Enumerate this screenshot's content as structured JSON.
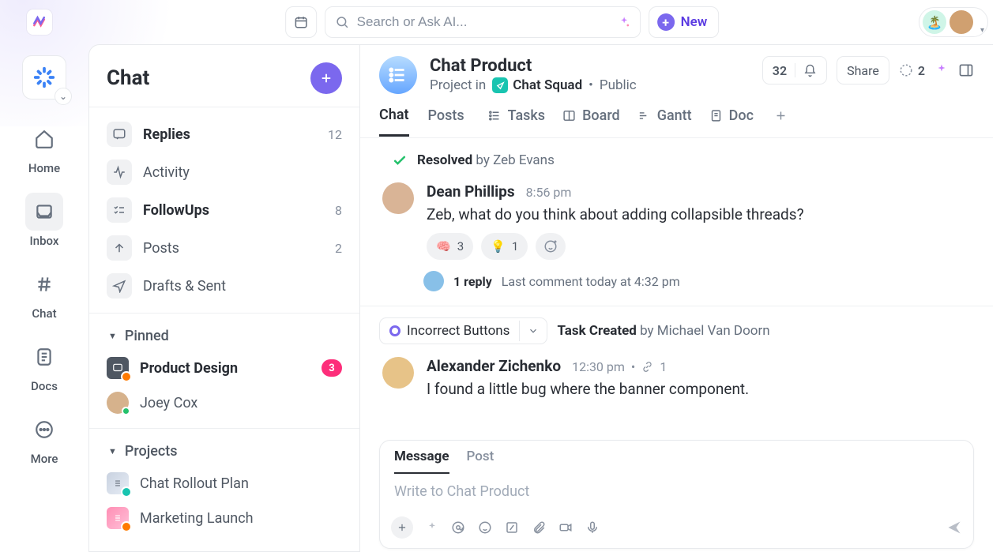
{
  "topbar": {
    "search_placeholder": "Search or Ask AI...",
    "new_label": "New"
  },
  "rail": {
    "items": [
      {
        "label": "Home"
      },
      {
        "label": "Inbox"
      },
      {
        "label": "Chat"
      },
      {
        "label": "Docs"
      },
      {
        "label": "More"
      }
    ]
  },
  "sidebar": {
    "title": "Chat",
    "inbox": [
      {
        "label": "Replies",
        "count": "12",
        "strong": true
      },
      {
        "label": "Activity"
      },
      {
        "label": "FollowUps",
        "count": "8",
        "strong": true
      },
      {
        "label": "Posts",
        "count": "2"
      },
      {
        "label": "Drafts & Sent"
      }
    ],
    "pinned_heading": "Pinned",
    "pinned": [
      {
        "label": "Product Design",
        "badge": "3",
        "strong": true
      },
      {
        "label": "Joey Cox"
      }
    ],
    "projects_heading": "Projects",
    "projects": [
      {
        "label": "Chat Rollout Plan"
      },
      {
        "label": "Marketing Launch"
      }
    ]
  },
  "space": {
    "title": "Chat Product",
    "project_in": "Project in",
    "squad": "Chat Squad",
    "visibility": "Public",
    "count": "32",
    "share": "Share",
    "coauthors": "2"
  },
  "tabs": {
    "chat": "Chat",
    "posts": "Posts",
    "tasks": "Tasks",
    "board": "Board",
    "gantt": "Gantt",
    "doc": "Doc"
  },
  "thread": {
    "resolved_label": "Resolved",
    "resolved_by": "by Zeb Evans",
    "msg1": {
      "author": "Dean Phillips",
      "time": "8:56 pm",
      "text": "Zeb, what do you think about adding collapsible threads?",
      "react_brain": "3",
      "react_bulb": "1",
      "brain_emoji": "🧠",
      "bulb_emoji": "💡",
      "reply_count": "1 reply",
      "reply_meta": "Last comment today at 4:32 pm"
    },
    "task": {
      "title": "Incorrect Buttons",
      "created_label": "Task Created",
      "created_by": "by Michael Van Doorn"
    },
    "msg2": {
      "author": "Alexander Zichenko",
      "time": "12:30 pm",
      "links": "1",
      "text": "I found a little bug where the banner component."
    }
  },
  "composer": {
    "tab_message": "Message",
    "tab_post": "Post",
    "placeholder": "Write to Chat Product"
  }
}
